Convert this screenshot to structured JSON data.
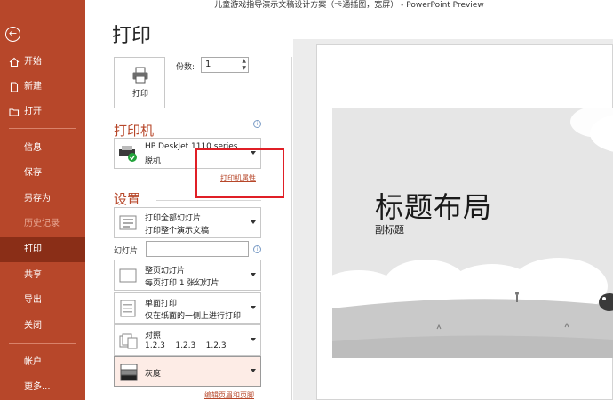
{
  "window": {
    "title": "儿童游戏指导演示文稿设计方案（卡通插图，宽屏）  -  PowerPoint Preview"
  },
  "sidebar": {
    "back_icon": "back-arrow-icon",
    "items": [
      {
        "label": "开始",
        "icon": "home-icon"
      },
      {
        "label": "新建",
        "icon": "new-document-icon"
      },
      {
        "label": "打开",
        "icon": "open-folder-icon"
      },
      {
        "label": "信息"
      },
      {
        "label": "保存"
      },
      {
        "label": "另存为"
      },
      {
        "label": "历史记录"
      },
      {
        "label": "打印"
      },
      {
        "label": "共享"
      },
      {
        "label": "导出"
      },
      {
        "label": "关闭"
      },
      {
        "label": "帐户"
      },
      {
        "label": "更多..."
      }
    ]
  },
  "print": {
    "title": "打印",
    "button_label": "打印",
    "copies_label": "份数:",
    "copies_value": "1",
    "printer_header": "打印机",
    "printer_name": "HP DeskJet 1110 series",
    "printer_status": "脱机",
    "printer_properties": "打印机属性",
    "settings_header": "设置",
    "range": {
      "line1": "打印全部幻灯片",
      "line2": "打印整个演示文稿"
    },
    "slides_label": "幻灯片:",
    "slides_value": "",
    "layout": {
      "line1": "整页幻灯片",
      "line2": "每页打印 1 张幻灯片"
    },
    "sides": {
      "line1": "单面打印",
      "line2": "仅在纸面的一侧上进行打印"
    },
    "collate": {
      "line1": "对照",
      "line2": "1,2,3    1,2,3    1,2,3"
    },
    "color": {
      "line1": "灰度"
    },
    "edit_header_footer": "编辑页眉和页脚"
  },
  "preview": {
    "slide_title": "标题布局",
    "slide_subtitle": "副标题"
  },
  "colors": {
    "accent": "#b7472a",
    "accent_dark": "#8a2e17",
    "highlight_box": "#e01f26"
  }
}
